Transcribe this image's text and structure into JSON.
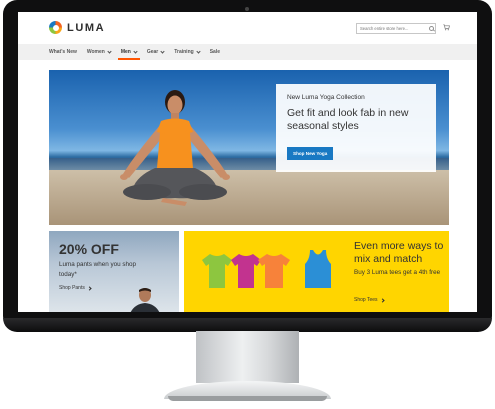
{
  "brand": {
    "name": "LUMA"
  },
  "search": {
    "placeholder": "Search entire store here..."
  },
  "nav": {
    "items": [
      {
        "label": "What's New",
        "has_menu": false
      },
      {
        "label": "Women",
        "has_menu": true
      },
      {
        "label": "Men",
        "has_menu": true,
        "active": true
      },
      {
        "label": "Gear",
        "has_menu": true
      },
      {
        "label": "Training",
        "has_menu": true
      },
      {
        "label": "Sale",
        "has_menu": false
      }
    ]
  },
  "hero": {
    "kicker": "New Luma Yoga Collection",
    "title": "Get fit and look fab in new seasonal styles",
    "button_label": "Shop New Yoga"
  },
  "promo_pants": {
    "title": "20% OFF",
    "text": "Luma pants when you shop today*",
    "link_label": "Shop Pants"
  },
  "promo_tees": {
    "title": "Even more ways to mix and match",
    "text": "Buy 3 Luma tees get a 4th free",
    "link_label": "Shop Tees"
  },
  "colors": {
    "accent": "#ff5501",
    "primary_button": "#1979c3",
    "promo_yellow": "#ffd500",
    "nav_background": "#f0f0f0",
    "tee_green": "#8dc63f",
    "tee_magenta": "#c2338f",
    "tee_orange": "#f7823a",
    "tank_blue": "#2b8fd6"
  }
}
